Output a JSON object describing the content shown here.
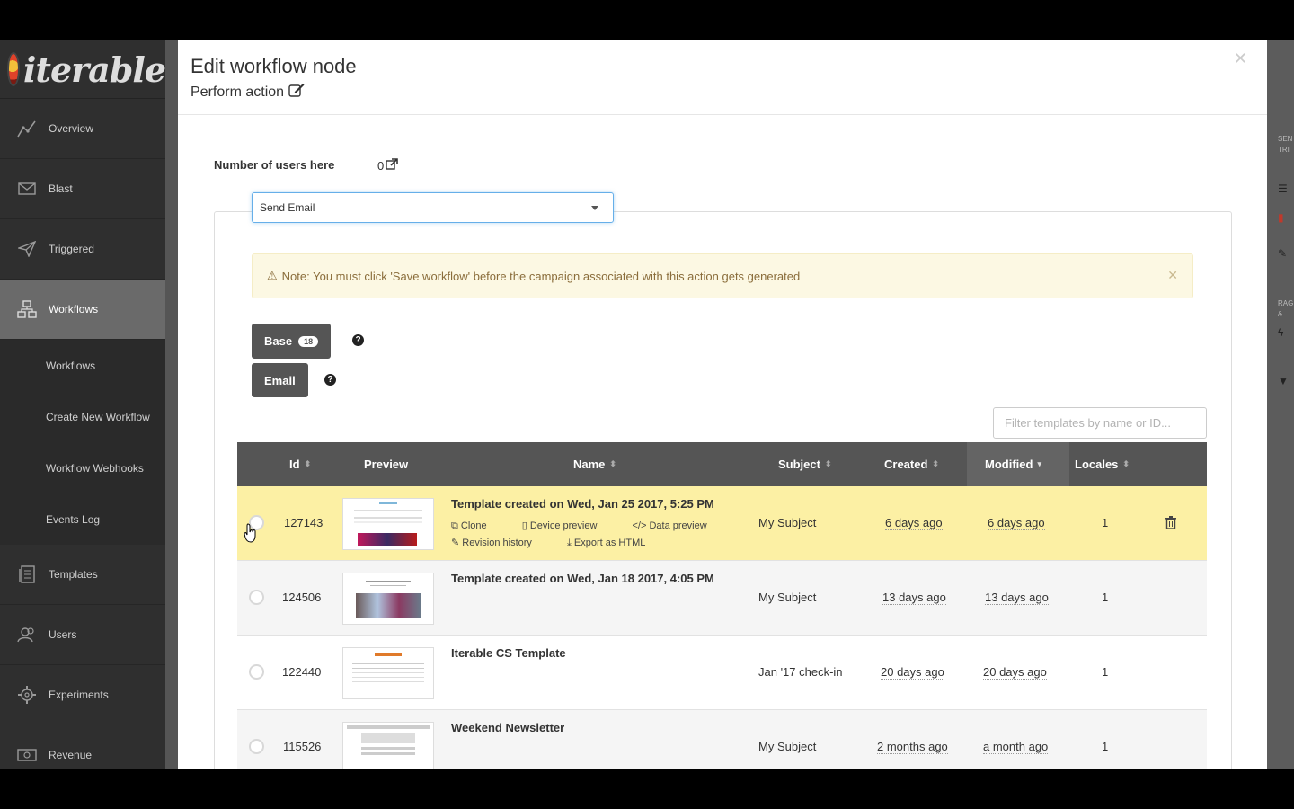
{
  "sidebar": {
    "brand": "iterable",
    "items": [
      {
        "label": "Overview",
        "icon": "overview-chart-icon"
      },
      {
        "label": "Blast",
        "icon": "envelope-icon"
      },
      {
        "label": "Triggered",
        "icon": "paper-plane-icon"
      },
      {
        "label": "Workflows",
        "icon": "workflow-icon"
      },
      {
        "label": "Templates",
        "icon": "templates-icon"
      },
      {
        "label": "Users",
        "icon": "users-icon"
      },
      {
        "label": "Experiments",
        "icon": "experiments-gear-icon"
      },
      {
        "label": "Revenue",
        "icon": "revenue-money-icon"
      }
    ],
    "submenu": [
      "Workflows",
      "Create New Workflow",
      "Workflow Webhooks",
      "Events Log"
    ]
  },
  "background": {
    "right_text_1": "SEN",
    "right_text_2": "TRI",
    "right_text_3": "RAG &"
  },
  "modal": {
    "title": "Edit workflow node",
    "subtitle": "Perform action",
    "users_label": "Number of users here",
    "users_value": "0",
    "action_select": "Send Email",
    "alert": "Note: You must click 'Save workflow' before the campaign associated with this action gets generated",
    "base_button": "Base",
    "base_count": "18",
    "email_button": "Email",
    "filter_placeholder": "Filter templates by name or ID...",
    "table": {
      "headers": {
        "id": "Id",
        "preview": "Preview",
        "name": "Name",
        "subject": "Subject",
        "created": "Created",
        "modified": "Modified",
        "locales": "Locales"
      },
      "actions": {
        "clone": "Clone",
        "device_preview": "Device preview",
        "data_preview": "Data preview",
        "revision_history": "Revision history",
        "export_html": "Export as HTML"
      },
      "rows": [
        {
          "id": "127143",
          "name": "Template created on Wed, Jan 25 2017, 5:25 PM",
          "subject": "My Subject",
          "created": "6 days ago",
          "modified": "6 days ago",
          "locales": "1"
        },
        {
          "id": "124506",
          "name": "Template created on Wed, Jan 18 2017, 4:05 PM",
          "subject": "My Subject",
          "created": "13 days ago",
          "modified": "13 days ago",
          "locales": "1"
        },
        {
          "id": "122440",
          "name": "Iterable CS Template",
          "subject": "Jan '17 check-in",
          "created": "20 days ago",
          "modified": "20 days ago",
          "locales": "1"
        },
        {
          "id": "115526",
          "name": "Weekend Newsletter",
          "subject": "My Subject",
          "created": "2 months ago",
          "modified": "a month ago",
          "locales": "1"
        }
      ]
    }
  }
}
